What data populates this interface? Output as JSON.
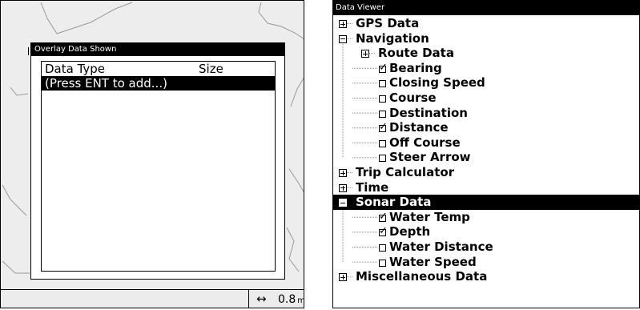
{
  "overlay_dialog": {
    "title": "Overlay Data Shown",
    "columns": {
      "type": "Data Type",
      "size": "Size"
    },
    "rows": [
      "(Press ENT to add...)"
    ]
  },
  "status_bar": {
    "arrow_icon": "left-right-arrow-icon",
    "distance": "0.8",
    "unit": "mi"
  },
  "data_viewer": {
    "title": "Data Viewer",
    "tree": [
      {
        "label": "GPS Data",
        "level": 0,
        "expander": "plus"
      },
      {
        "label": "Navigation",
        "level": 0,
        "expander": "minus"
      },
      {
        "label": "Route Data",
        "level": 1,
        "expander": "plus"
      },
      {
        "label": "Bearing",
        "level": 1,
        "checked": true
      },
      {
        "label": "Closing Speed",
        "level": 1,
        "checked": false
      },
      {
        "label": "Course",
        "level": 1,
        "checked": false
      },
      {
        "label": "Destination",
        "level": 1,
        "checked": false
      },
      {
        "label": "Distance",
        "level": 1,
        "checked": true
      },
      {
        "label": "Off Course",
        "level": 1,
        "checked": false
      },
      {
        "label": "Steer Arrow",
        "level": 1,
        "checked": false
      },
      {
        "label": "Trip Calculator",
        "level": 0,
        "expander": "plus"
      },
      {
        "label": "Time",
        "level": 0,
        "expander": "plus"
      },
      {
        "label": "Sonar Data",
        "level": 0,
        "expander": "minus",
        "selected": true
      },
      {
        "label": "Water Temp",
        "level": 1,
        "checked": true
      },
      {
        "label": "Depth",
        "level": 1,
        "checked": true
      },
      {
        "label": "Water Distance",
        "level": 1,
        "checked": false
      },
      {
        "label": "Water Speed",
        "level": 1,
        "checked": false
      },
      {
        "label": "Miscellaneous Data",
        "level": 0,
        "expander": "plus"
      }
    ]
  }
}
